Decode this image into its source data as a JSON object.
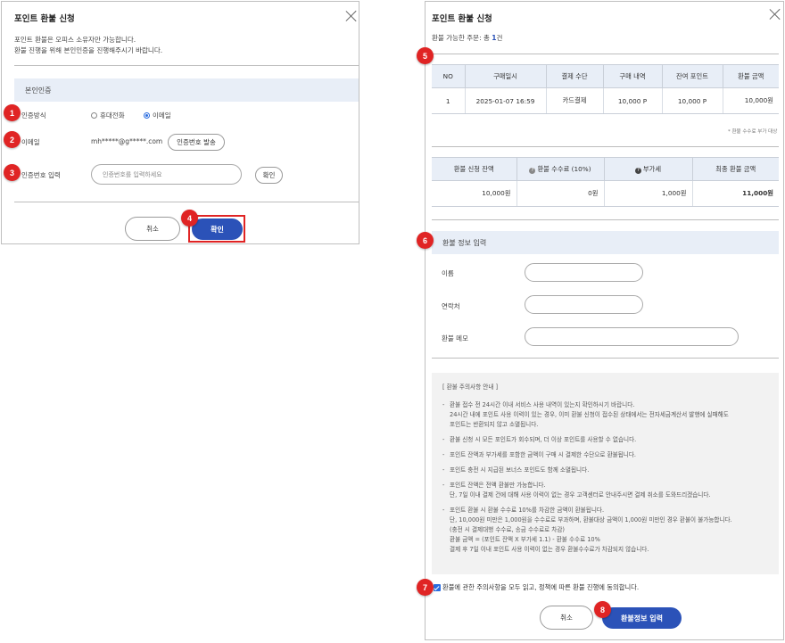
{
  "left_dialog": {
    "title": "포인트 환불 신청",
    "desc_line1": "포인트 환불은 오피스 소유자만 가능합니다.",
    "desc_line2": "환불 진행을 위해 본인인증을 진행해주시기 바랍니다.",
    "section_title": "본인인증",
    "auth_method_label": "인증방식",
    "auth_option_phone": "휴대전화",
    "auth_option_email": "이메일",
    "email_label": "이메일",
    "email_value": "mh*****@g*****.com",
    "send_code_button": "인증번호 발송",
    "code_label": "인증번호 입력",
    "code_placeholder": "인증번호를 입력하세요",
    "verify_button": "확인",
    "cancel_button": "취소",
    "confirm_button": "확인"
  },
  "right_dialog": {
    "title": "포인트 환불 신청",
    "refundable_orders_prefix": "환불 가능한 주문: 총 ",
    "refundable_orders_count": "1",
    "refundable_orders_suffix": "건",
    "orders_table": {
      "headers": [
        "NO",
        "구매일시",
        "결제 수단",
        "구매 내역",
        "잔여 포인트",
        "환불 금액"
      ],
      "rows": [
        [
          "1",
          "2025-01-07 16:59",
          "카드결제",
          "10,000 P",
          "10,000 P",
          "10,000원"
        ]
      ]
    },
    "fee_note": "* 환불 수수료 부가 대상",
    "summary_table": {
      "headers": [
        "환불 신청 잔액",
        "환불 수수료 (10%)",
        "부가세",
        "최종 환불 금액"
      ],
      "values": [
        "10,000원",
        "0원",
        "1,000원",
        "11,000원"
      ]
    },
    "info_section_title": "환불 정보 입력",
    "name_label": "이름",
    "contact_label": "연락처",
    "memo_label": "환불 메모",
    "notice_title": "[ 환불 주의사항 안내 ]",
    "notice": {
      "b1_l1": "환불 접수 전 24시간 이내 서비스 사용 내역이 있는지 확인하시기 바랍니다.",
      "b1_l2": "24시간 내에 포인트 사용 이력이 있는 경우, 이미 환불 신청이 접수된 상태에서는 전자세금계산서 발행에 실패해도",
      "b1_l3": "포인트는 반환되지 않고 소멸됩니다.",
      "b2": "환불 신청 시 모든 포인트가 회수되며, 더 이상 포인트를 사용할 수 없습니다.",
      "b3": "포인트 잔액과 부가세를 포함한 금액이 구매 시 결제한 수단으로 환불됩니다.",
      "b4": "포인트 충전 시 지급된 보너스 포인트도 함께 소멸됩니다.",
      "b5_l1": "포인트 잔액은 전액 환불만 가능합니다.",
      "b5_l2": "단, 7일 이내 결제 건에 대해 사용 이력이 없는 경우 고객센터로 안내주시면 결제 취소를 도와드리겠습니다.",
      "b6_l1": "포인트 환불 시 환불 수수료 10%를 차감한 금액이 환불됩니다.",
      "b6_l2": "단, 10,000원 미만은 1,000원을 수수료로 부과하며, 환불대상 금액이 1,000원 미만인 경우 환불이 불가능합니다.",
      "b6_l3": "(충전 시 결제대행 수수료, 송금 수수료로 차감)",
      "b6_l4": "환불 금액 = (포인트 잔액 X 부가세 1.1) - 환불 수수료 10%",
      "b6_l5": "결제 후 7일 이내 포인트 사용 이력이 없는 경우 환불수수료가 차감되지 않습니다."
    },
    "agree_text": "환불에 관한 주의사항을 모두 읽고, 정책에 따른 환불 진행에 동의합니다.",
    "cancel_button": "취소",
    "submit_button": "환불정보 입력"
  },
  "badges": [
    "1",
    "2",
    "3",
    "4",
    "5",
    "6",
    "7",
    "8"
  ],
  "colors": {
    "primary": "#2b52b8",
    "badge": "#e02424",
    "section_bg": "#e8eef7"
  }
}
